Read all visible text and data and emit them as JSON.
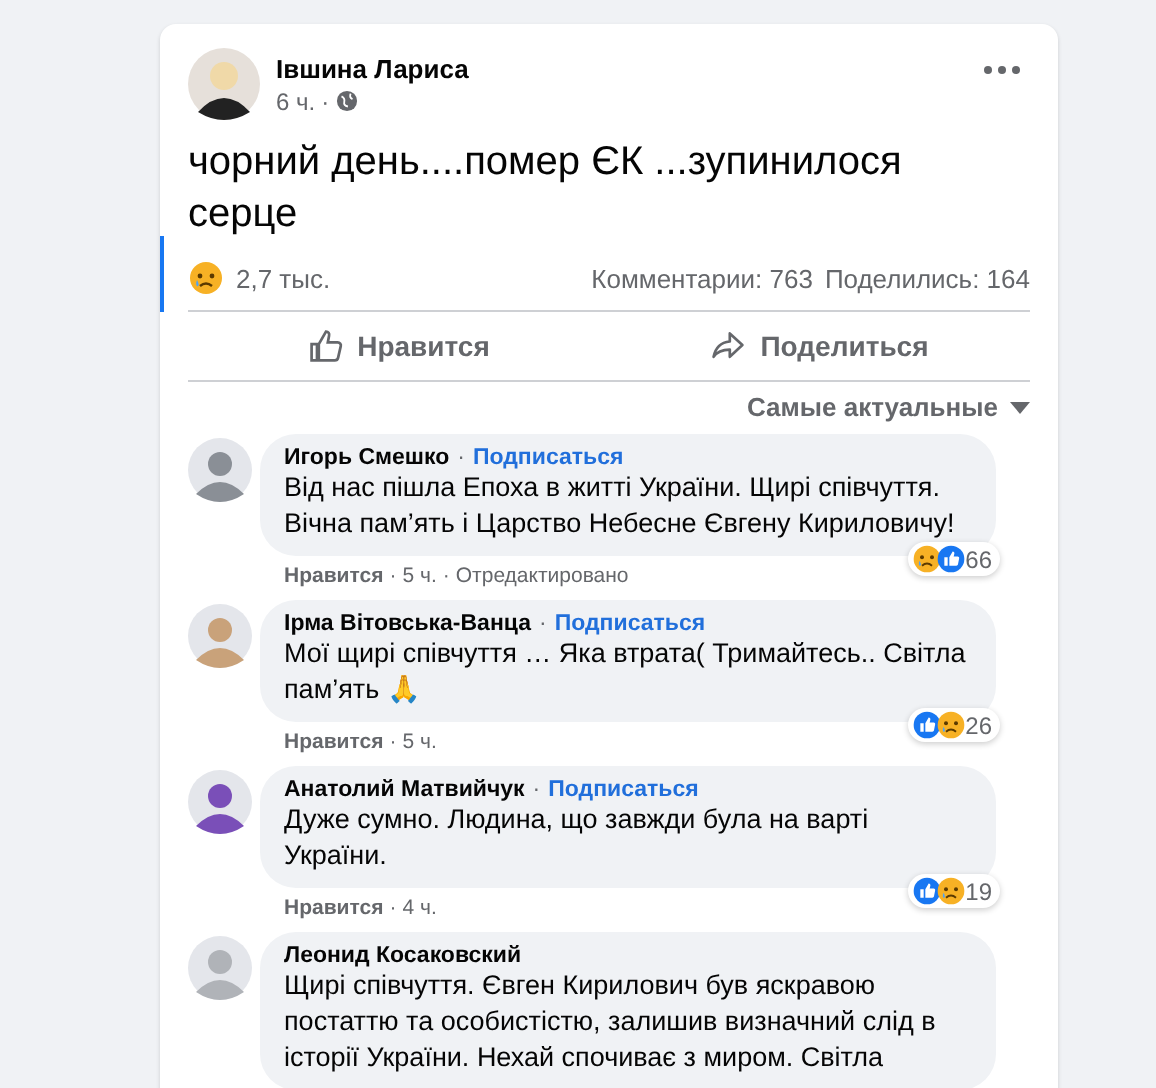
{
  "post": {
    "author": "Івшина Лариса",
    "time": "6 ч.",
    "separator": "·",
    "text": "чорний день....помер ЄК ...зупинилося серце",
    "reactions": {
      "kinds": [
        {
          "kind": "sad"
        }
      ],
      "count": "2,7 тыс."
    },
    "comments_count": "Комментарии: 763",
    "shares_count": "Поделились: 164"
  },
  "actions": [
    {
      "kind": "like",
      "label": "Нравится"
    },
    {
      "kind": "share",
      "label": "Поделиться"
    }
  ],
  "sort": {
    "label": "Самые актуальные"
  },
  "comments": [
    {
      "author": "Игорь Смешко",
      "dot": "·",
      "follow": "Подписаться",
      "text": "Від нас пішла Епоха в житті України. Щирі співчуття. Вічна пам’ять і Царство Небесне Євгену Кириловичу!",
      "reactions": [
        {
          "kind": "sad"
        },
        {
          "kind": "like"
        }
      ],
      "count": "66",
      "like": "Нравится",
      "time": "5 ч.",
      "edited": "Отредактировано"
    },
    {
      "author": "Ірма Вітовська-Ванца",
      "dot": "·",
      "follow": "Подписаться",
      "text": "Мої щирі співчуття … Яка втрата( Тримайтесь.. Світла пам’ять 🙏",
      "reactions": [
        {
          "kind": "like"
        },
        {
          "kind": "sad"
        }
      ],
      "count": "26",
      "like": "Нравится",
      "time": "5 ч."
    },
    {
      "author": "Анатолий Матвийчук",
      "dot": "·",
      "follow": "Подписаться",
      "text": "Дуже сумно. Людина, що завжди була на варті України.",
      "reactions": [
        {
          "kind": "like"
        },
        {
          "kind": "sad"
        }
      ],
      "count": "19",
      "like": "Нравится",
      "time": "4 ч."
    },
    {
      "author": "Леонид Косаковский",
      "text": "Щирі співчуття. Євген Кирилович був яскравою постаттю та особистістю, залишив визначний слід в історії України. Нехай спочиває з миром. Світла"
    }
  ]
}
